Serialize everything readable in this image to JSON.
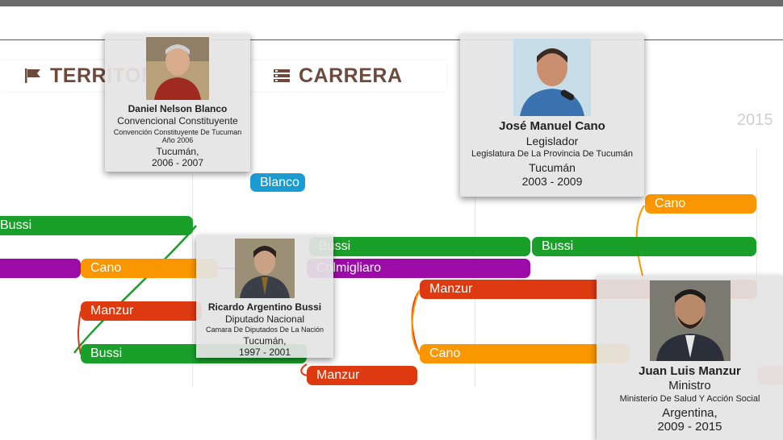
{
  "tabs": [
    {
      "label": "TERRITORIO",
      "icon": "flag-icon"
    },
    {
      "label": "CARRERA",
      "icon": "list-icon"
    }
  ],
  "years": [
    "2015"
  ],
  "bars": [
    {
      "label": "Bussi",
      "color": "green"
    },
    {
      "label": "Cano",
      "color": "orange"
    },
    {
      "label": "Manzur",
      "color": "red"
    },
    {
      "label": "Bussi",
      "color": "green"
    },
    {
      "label": "Blanco",
      "color": "blue"
    },
    {
      "label": "Bussi",
      "color": "green"
    },
    {
      "label": "Bussi",
      "color": "green"
    },
    {
      "label": "Cano",
      "color": "orange"
    },
    {
      "label": "Colmigliaro",
      "color": "purple"
    },
    {
      "label": "Manzur",
      "color": "red"
    },
    {
      "label": "Cano",
      "color": "orange"
    },
    {
      "label": "Manzur",
      "color": "red"
    }
  ],
  "cards": {
    "blanco": {
      "name": "Daniel Nelson Blanco",
      "role": "Convencional Constituyente",
      "institution": "Convención Constituyente De Tucuman",
      "extra": "Año 2006",
      "place": "Tucumán,",
      "years": "2006 - 2007"
    },
    "cano": {
      "name": "José Manuel Cano",
      "role": "Legislador",
      "institution": "Legislatura De La Provincia De Tucumán",
      "place": "Tucumán",
      "years": "2003 - 2009"
    },
    "bussi": {
      "name": "Ricardo Argentino Bussi",
      "role": "Diputado Nacional",
      "institution": "Camara De Diputados De La Nación",
      "place": "Tucumán,",
      "years": "1997 - 2001"
    },
    "manzur": {
      "name": "Juan Luis Manzur",
      "role": "Ministro",
      "institution": "Ministerio De Salud Y Acción Social",
      "place": "Argentina,",
      "years": "2009 - 2015"
    }
  },
  "colors": {
    "green": "#1a9f2a",
    "purple": "#9c0aa8",
    "orange": "#fa9700",
    "red": "#de3a12",
    "blue": "#1a9cd3",
    "tab_text": "#6e4a3e"
  }
}
